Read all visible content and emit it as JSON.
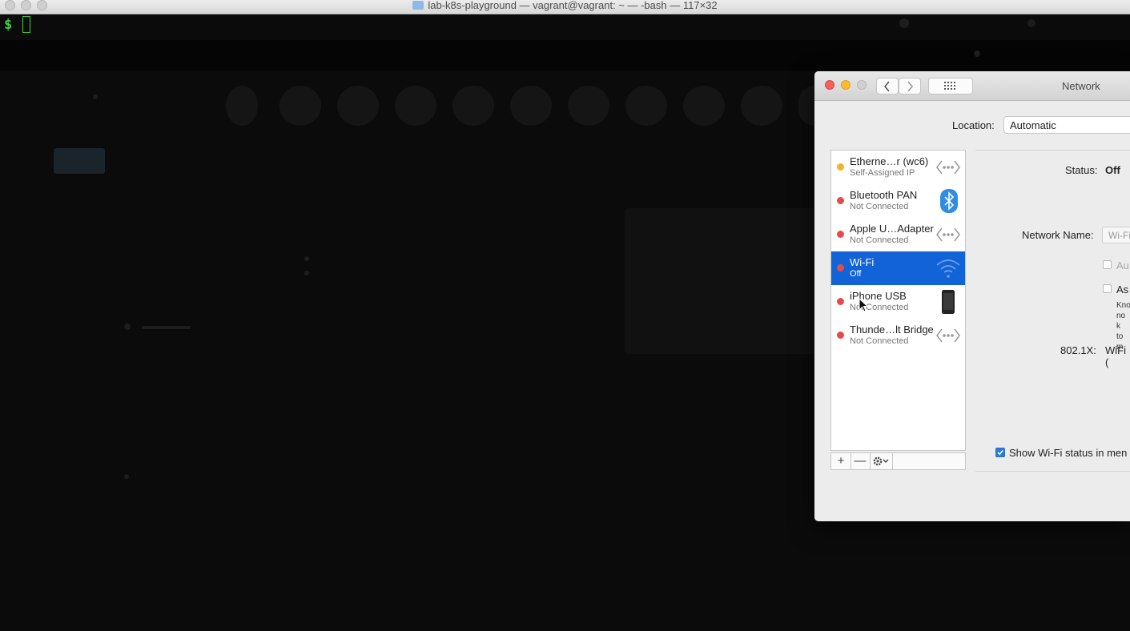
{
  "terminal": {
    "title": "lab-k8s-playground — vagrant@vagrant: ~ — -bash — 117×32",
    "prompt": "$"
  },
  "network_window": {
    "title": "Network",
    "location_label": "Location:",
    "location_value": "Automatic",
    "services": [
      {
        "name": "Etherne…r (wc6)",
        "status": "Self-Assigned IP",
        "dot_color": "#f0b429",
        "icon": "ethernet-icon",
        "selected": false
      },
      {
        "name": "Bluetooth PAN",
        "status": "Not Connected",
        "dot_color": "#e84a4a",
        "icon": "bluetooth-icon",
        "selected": false
      },
      {
        "name": "Apple U…Adapter",
        "status": "Not Connected",
        "dot_color": "#e84a4a",
        "icon": "ethernet-icon",
        "selected": false
      },
      {
        "name": "Wi-Fi",
        "status": "Off",
        "dot_color": "#e84a4a",
        "icon": "wifi-icon",
        "selected": true
      },
      {
        "name": "iPhone USB",
        "status": "Not Connected",
        "dot_color": "#e84a4a",
        "icon": "iphone-icon",
        "selected": false
      },
      {
        "name": "Thunde…lt Bridge",
        "status": "Not Connected",
        "dot_color": "#e84a4a",
        "icon": "ethernet-icon",
        "selected": false
      }
    ],
    "list_bar": {
      "add": "+",
      "remove": "—"
    },
    "detail": {
      "status_label": "Status:",
      "status_value": "Off",
      "network_name_label": "Network Name:",
      "network_name_value": "Wi-Fi",
      "auto_join_label": "Au",
      "ask_join_label": "As",
      "help_lines": [
        "Kno",
        "no k",
        "to m"
      ],
      "dot1x_label": "802.1X:",
      "dot1x_value": "WiFi (",
      "show_status_label": "Show Wi-Fi status in men",
      "show_status_checked": true
    }
  }
}
